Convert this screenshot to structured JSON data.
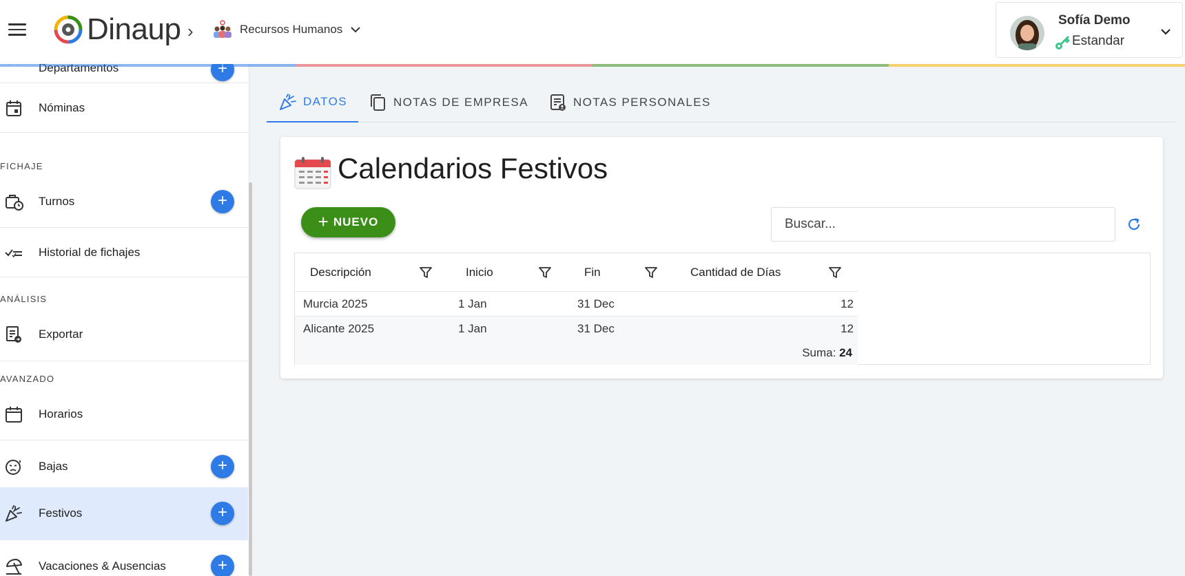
{
  "header": {
    "logo_text": "Dinaup",
    "module_label": "Recursos Humanos",
    "strip_colors": [
      "#2f7be5",
      "#e5484d",
      "#3b8f18",
      "#f4b400"
    ]
  },
  "user": {
    "name": "Sofía Demo",
    "role": "Estandar"
  },
  "sidebar": {
    "items": [
      {
        "label": "Departamentos",
        "icon": "people-icon"
      },
      {
        "label": "Nóminas",
        "icon": "calendar-icon"
      },
      {
        "label": "Turnos",
        "icon": "briefcase-clock-icon"
      },
      {
        "label": "Historial de fichajes",
        "icon": "checklist-icon"
      },
      {
        "label": "Exportar",
        "icon": "export-document-icon"
      },
      {
        "label": "Horarios",
        "icon": "calendar-icon"
      },
      {
        "label": "Bajas",
        "icon": "sick-face-icon"
      },
      {
        "label": "Festivos",
        "icon": "party-popper-icon"
      },
      {
        "label": "Vacaciones & Ausencias",
        "icon": "beach-umbrella-icon"
      }
    ],
    "sections": {
      "fichaje": "FICHAJE",
      "analisis": "ANÁLISIS",
      "avanzado": "AVANZADO"
    },
    "add_symbol": "+"
  },
  "tabs": [
    {
      "label": "DATOS",
      "icon": "party-popper-icon",
      "active": true
    },
    {
      "label": "NOTAS DE EMPRESA",
      "icon": "copy-notes-icon",
      "active": false
    },
    {
      "label": "NOTAS PERSONALES",
      "icon": "personal-notes-icon",
      "active": false
    }
  ],
  "card": {
    "title": "Calendarios Festivos",
    "new_button": "NUEVO",
    "new_symbol": "+",
    "search_placeholder": "Buscar..."
  },
  "table": {
    "columns": [
      "Descripción",
      "Inicio",
      "Fin",
      "Cantidad de Días"
    ],
    "rows": [
      {
        "descripcion": "Murcia 2025",
        "inicio": "1 Jan",
        "fin": "31 Dec",
        "cantidad": "12"
      },
      {
        "descripcion": "Alicante 2025",
        "inicio": "1 Jan",
        "fin": "31 Dec",
        "cantidad": "12"
      }
    ],
    "summary_label": "Suma:",
    "summary_value": "24"
  }
}
